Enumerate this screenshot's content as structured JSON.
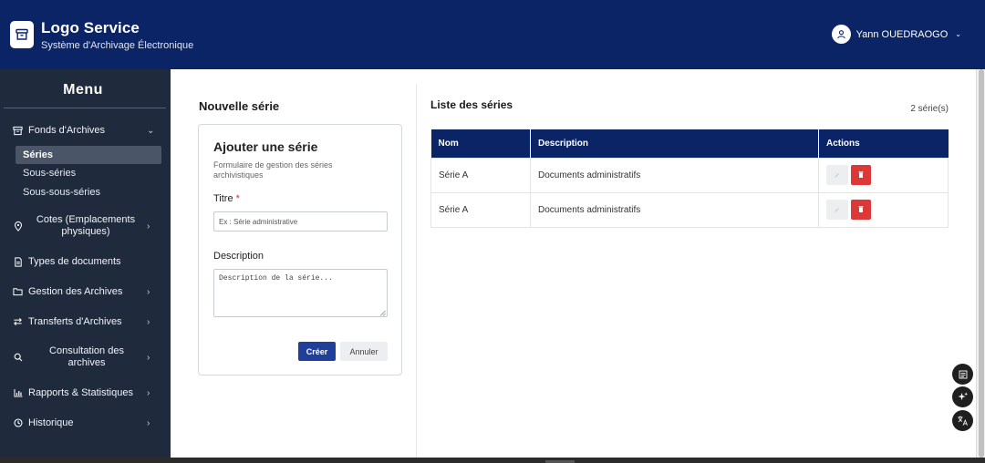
{
  "header": {
    "app_title": "Logo Service",
    "app_subtitle": "Système d'Archivage Électronique",
    "user_name": "Yann OUEDRAOGO"
  },
  "sidebar": {
    "menu_title": "Menu",
    "items": [
      {
        "label": "Fonds d'Archives",
        "icon": "archive-icon",
        "expanded": true
      },
      {
        "label": "Cotes (Emplacements physiques)",
        "icon": "location-pin-icon"
      },
      {
        "label": "Types de documents",
        "icon": "document-icon"
      },
      {
        "label": "Gestion des Archives",
        "icon": "folder-icon"
      },
      {
        "label": "Transferts d'Archives",
        "icon": "transfer-icon"
      },
      {
        "label": "Consultation des archives",
        "icon": "search-icon"
      },
      {
        "label": "Rapports & Statistiques",
        "icon": "bar-chart-icon"
      },
      {
        "label": "Historique",
        "icon": "clock-icon"
      }
    ],
    "sub_items": [
      {
        "label": "Séries",
        "active": true
      },
      {
        "label": "Sous-séries"
      },
      {
        "label": "Sous-sous-séries"
      }
    ]
  },
  "form": {
    "section_title": "Nouvelle série",
    "card_title": "Ajouter une série",
    "card_description": "Formulaire de gestion des séries archivistiques",
    "title_label": "Titre",
    "title_required": "*",
    "title_placeholder": "Ex : Série administrative",
    "title_value": "",
    "description_label": "Description",
    "description_placeholder": "Description de la série...",
    "description_value": "",
    "create_label": "Créer",
    "cancel_label": "Annuler"
  },
  "list": {
    "title": "Liste des séries",
    "count": "2 série(s)",
    "columns": [
      "Nom",
      "Description",
      "Actions"
    ],
    "rows": [
      {
        "nom": "Série A",
        "description": "Documents administratifs"
      },
      {
        "nom": "Série A",
        "description": "Documents administratifs"
      }
    ]
  },
  "colors": {
    "header_bg": "#0b2466",
    "sidebar_bg": "#1f2a3c",
    "primary_button": "#1f3f9a",
    "delete_button": "#dc3838"
  }
}
